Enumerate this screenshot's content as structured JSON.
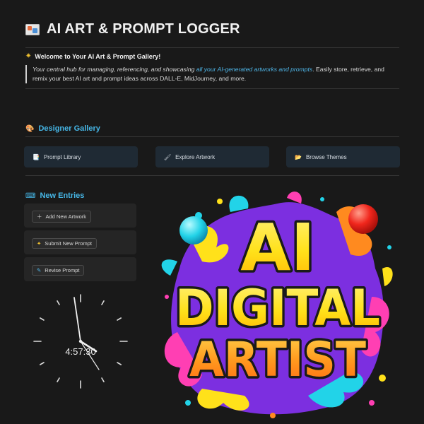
{
  "page": {
    "title": "AI ART & PROMPT LOGGER",
    "title_icon": "framed-picture-icon"
  },
  "welcome": {
    "heading": "Welcome to Your AI Art & Prompt Gallery!",
    "icon": "sun-icon",
    "callout_lead": "Your central hub for managing, referencing, and showcasing ",
    "callout_highlight": "all your AI-generated artworks and prompts",
    "callout_rest": ". Easily store, retrieve, and remix your best AI art and prompt ideas across DALL-E, MidJourney, and more."
  },
  "gallery": {
    "heading": "Designer Gallery",
    "icon": "palette-icon",
    "buttons": [
      {
        "label": "Prompt Library",
        "icon": "bookmark-icon"
      },
      {
        "label": "Explore Artwork",
        "icon": "paintbrush-icon"
      },
      {
        "label": "Browse Themes",
        "icon": "folder-icon"
      }
    ]
  },
  "entries": {
    "heading": "New Entries",
    "icon": "keyboard-icon",
    "buttons": [
      {
        "label": "Add New Artwork",
        "icon": "plus-icon"
      },
      {
        "label": "Submit New Prompt",
        "icon": "sparkle-icon"
      },
      {
        "label": "Revise Prompt",
        "icon": "edit-icon"
      }
    ]
  },
  "clock": {
    "time": "4:57:30",
    "hours": 4,
    "minutes": 57,
    "seconds": 30
  },
  "artwork": {
    "line1": "AI",
    "line2": "DIGITAL",
    "line3": "ARTIST"
  },
  "colors": {
    "accent": "#46b6e6",
    "background": "#191919",
    "nav_button": "#1f2a34",
    "card": "#252525"
  }
}
